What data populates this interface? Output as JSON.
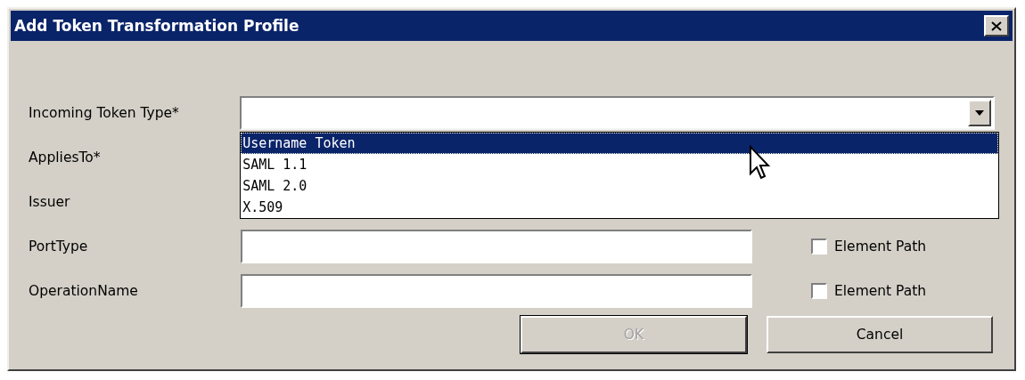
{
  "window": {
    "title": "Add Token Transformation Profile"
  },
  "rows": [
    {
      "kind": "combo",
      "label": "Incoming Token Type*",
      "expanded": true,
      "options": [
        {
          "label": "Username Token",
          "selected": true
        },
        {
          "label": "SAML 1.1",
          "selected": false
        },
        {
          "label": "SAML 2.0",
          "selected": false
        },
        {
          "label": "X.509",
          "selected": false
        }
      ]
    },
    {
      "kind": "covered",
      "label": "AppliesTo*"
    },
    {
      "kind": "covered",
      "label": "Issuer"
    },
    {
      "kind": "text",
      "label": "PortType",
      "option": {
        "label": "Element Path",
        "checked": false
      }
    },
    {
      "kind": "text",
      "label": "OperationName",
      "option": {
        "label": "Element Path",
        "checked": false
      }
    }
  ],
  "buttons": [
    {
      "label": "OK",
      "disabled": true
    },
    {
      "label": "Cancel",
      "disabled": false
    }
  ]
}
